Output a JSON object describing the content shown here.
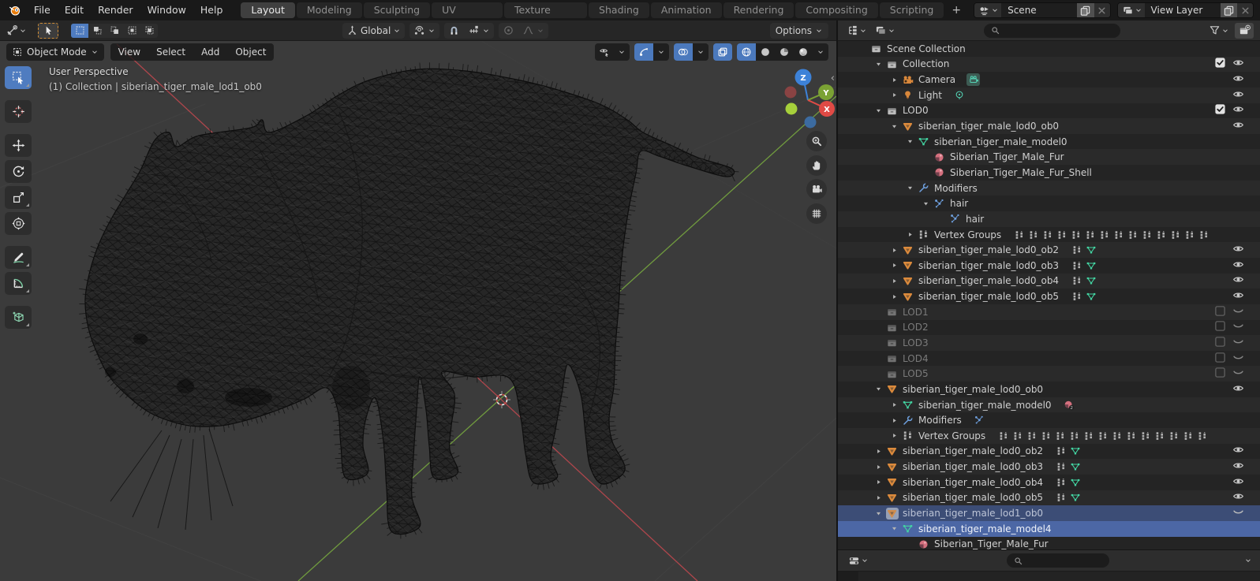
{
  "topbar": {
    "menus": [
      "File",
      "Edit",
      "Render",
      "Window",
      "Help"
    ],
    "tabs": [
      "Layout",
      "Modeling",
      "Sculpting",
      "UV Editing",
      "Texture Paint",
      "Shading",
      "Animation",
      "Rendering",
      "Compositing",
      "Scripting"
    ],
    "active_tab": "Layout",
    "add_tab_label": "+",
    "scene": {
      "value": "Scene"
    },
    "view_layer": {
      "value": "View Layer"
    }
  },
  "tool_settings": {
    "select_modes": [
      "set",
      "extend",
      "subtract",
      "invert",
      "intersect"
    ],
    "active_select_mode": "set",
    "orientation_label": "Global",
    "options_label": "Options"
  },
  "viewport": {
    "mode_label": "Object Mode",
    "menus": [
      "View",
      "Select",
      "Add",
      "Object"
    ],
    "overlay_line1": "User Perspective",
    "overlay_line2": "(1) Collection | siberian_tiger_male_lod1_ob0",
    "gizmo": {
      "x": "X",
      "y": "Y",
      "z": "Z"
    },
    "nav_buttons": [
      "zoom",
      "pan",
      "camera-view",
      "toggle-ortho"
    ],
    "shading_modes": [
      "wireframe",
      "solid",
      "material-preview",
      "rendered"
    ],
    "active_shading": "wireframe"
  },
  "toolbar_tools": [
    {
      "name": "select-box",
      "active": true,
      "sub": true
    },
    {
      "name": "cursor",
      "active": false,
      "sub": false
    },
    {
      "name": "move",
      "active": false,
      "sub": false
    },
    {
      "name": "rotate",
      "active": false,
      "sub": false
    },
    {
      "name": "scale",
      "active": false,
      "sub": true
    },
    {
      "name": "transform",
      "active": false,
      "sub": false
    },
    {
      "name": "annotate",
      "active": false,
      "sub": true
    },
    {
      "name": "measure",
      "active": false,
      "sub": true
    },
    {
      "name": "add-cube",
      "active": false,
      "sub": true
    }
  ],
  "outliner": {
    "search_placeholder": "",
    "rows": [
      {
        "label": "Scene Collection",
        "icon": "collection",
        "level": 0,
        "arrow": "none",
        "checkbox": "none",
        "eye": "none",
        "state": "normal",
        "badges": []
      },
      {
        "label": "Collection",
        "icon": "collection",
        "level": 1,
        "arrow": "open",
        "checkbox": "checked",
        "eye": "open",
        "state": "normal",
        "badges": []
      },
      {
        "label": "Camera",
        "icon": "camera-object",
        "level": 2,
        "arrow": "closed",
        "checkbox": "none",
        "eye": "open",
        "state": "normal",
        "badges": [
          {
            "type": "camera-data"
          }
        ]
      },
      {
        "label": "Light",
        "icon": "light-object",
        "level": 2,
        "arrow": "closed",
        "checkbox": "none",
        "eye": "open",
        "state": "normal",
        "badges": [
          {
            "type": "light-data"
          }
        ]
      },
      {
        "label": "LOD0",
        "icon": "collection",
        "level": 1,
        "arrow": "open",
        "checkbox": "checked",
        "eye": "open",
        "state": "normal",
        "badges": []
      },
      {
        "label": "siberian_tiger_male_lod0_ob0",
        "icon": "mesh-object",
        "level": 2,
        "arrow": "open",
        "checkbox": "none",
        "eye": "open",
        "state": "normal",
        "badges": []
      },
      {
        "label": "siberian_tiger_male_model0",
        "icon": "mesh-data",
        "level": 3,
        "arrow": "open",
        "checkbox": "none",
        "eye": "none",
        "state": "normal",
        "badges": []
      },
      {
        "label": "Siberian_Tiger_Male_Fur",
        "icon": "material",
        "level": 4,
        "arrow": "none",
        "checkbox": "none",
        "eye": "none",
        "state": "normal",
        "badges": []
      },
      {
        "label": "Siberian_Tiger_Male_Fur_Shell",
        "icon": "material",
        "level": 4,
        "arrow": "none",
        "checkbox": "none",
        "eye": "none",
        "state": "normal",
        "badges": []
      },
      {
        "label": "Modifiers",
        "icon": "modifier",
        "level": 3,
        "arrow": "open",
        "checkbox": "none",
        "eye": "none",
        "state": "normal",
        "badges": []
      },
      {
        "label": "hair",
        "icon": "particles",
        "level": 4,
        "arrow": "open",
        "checkbox": "none",
        "eye": "none",
        "state": "normal",
        "badges": []
      },
      {
        "label": "hair",
        "icon": "particles",
        "level": 5,
        "arrow": "none",
        "checkbox": "none",
        "eye": "none",
        "state": "normal",
        "badges": []
      },
      {
        "label": "Vertex Groups",
        "icon": "vertex-group",
        "level": 3,
        "arrow": "closed",
        "checkbox": "none",
        "eye": "none",
        "state": "normal",
        "badges": [
          {
            "type": "vertex-group",
            "count": 14
          }
        ]
      },
      {
        "label": "siberian_tiger_male_lod0_ob2",
        "icon": "mesh-object",
        "level": 2,
        "arrow": "closed",
        "checkbox": "none",
        "eye": "open",
        "state": "normal",
        "badges": [
          {
            "type": "vertex-group"
          },
          {
            "type": "mesh-data"
          }
        ]
      },
      {
        "label": "siberian_tiger_male_lod0_ob3",
        "icon": "mesh-object",
        "level": 2,
        "arrow": "closed",
        "checkbox": "none",
        "eye": "open",
        "state": "normal",
        "badges": [
          {
            "type": "vertex-group"
          },
          {
            "type": "mesh-data"
          }
        ]
      },
      {
        "label": "siberian_tiger_male_lod0_ob4",
        "icon": "mesh-object",
        "level": 2,
        "arrow": "closed",
        "checkbox": "none",
        "eye": "open",
        "state": "normal",
        "badges": [
          {
            "type": "vertex-group"
          },
          {
            "type": "mesh-data"
          }
        ]
      },
      {
        "label": "siberian_tiger_male_lod0_ob5",
        "icon": "mesh-object",
        "level": 2,
        "arrow": "closed",
        "checkbox": "none",
        "eye": "open",
        "state": "normal",
        "badges": [
          {
            "type": "vertex-group"
          },
          {
            "type": "mesh-data"
          }
        ]
      },
      {
        "label": "LOD1",
        "icon": "collection",
        "level": 1,
        "arrow": "none",
        "checkbox": "empty",
        "eye": "closed",
        "state": "grayed",
        "badges": []
      },
      {
        "label": "LOD2",
        "icon": "collection",
        "level": 1,
        "arrow": "none",
        "checkbox": "empty",
        "eye": "closed",
        "state": "grayed",
        "badges": []
      },
      {
        "label": "LOD3",
        "icon": "collection",
        "level": 1,
        "arrow": "none",
        "checkbox": "empty",
        "eye": "closed",
        "state": "grayed",
        "badges": []
      },
      {
        "label": "LOD4",
        "icon": "collection",
        "level": 1,
        "arrow": "none",
        "checkbox": "empty",
        "eye": "closed",
        "state": "grayed",
        "badges": []
      },
      {
        "label": "LOD5",
        "icon": "collection",
        "level": 1,
        "arrow": "none",
        "checkbox": "empty",
        "eye": "closed",
        "state": "grayed",
        "badges": []
      },
      {
        "label": "siberian_tiger_male_lod0_ob0",
        "icon": "mesh-object",
        "level": 1,
        "arrow": "open",
        "checkbox": "none",
        "eye": "open",
        "state": "normal",
        "badges": []
      },
      {
        "label": "siberian_tiger_male_model0",
        "icon": "mesh-data",
        "level": 2,
        "arrow": "closed",
        "checkbox": "none",
        "eye": "none",
        "state": "normal",
        "badges": [
          {
            "type": "material",
            "count": 2
          }
        ]
      },
      {
        "label": "Modifiers",
        "icon": "modifier",
        "level": 2,
        "arrow": "closed",
        "checkbox": "none",
        "eye": "none",
        "state": "normal",
        "badges": [
          {
            "type": "particles"
          }
        ]
      },
      {
        "label": "Vertex Groups",
        "icon": "vertex-group",
        "level": 2,
        "arrow": "closed",
        "checkbox": "none",
        "eye": "none",
        "state": "normal",
        "badges": [
          {
            "type": "vertex-group",
            "count": 15
          }
        ]
      },
      {
        "label": "siberian_tiger_male_lod0_ob2",
        "icon": "mesh-object",
        "level": 1,
        "arrow": "closed",
        "checkbox": "none",
        "eye": "open",
        "state": "normal",
        "badges": [
          {
            "type": "vertex-group"
          },
          {
            "type": "mesh-data"
          }
        ]
      },
      {
        "label": "siberian_tiger_male_lod0_ob3",
        "icon": "mesh-object",
        "level": 1,
        "arrow": "closed",
        "checkbox": "none",
        "eye": "open",
        "state": "normal",
        "badges": [
          {
            "type": "vertex-group"
          },
          {
            "type": "mesh-data"
          }
        ]
      },
      {
        "label": "siberian_tiger_male_lod0_ob4",
        "icon": "mesh-object",
        "level": 1,
        "arrow": "closed",
        "checkbox": "none",
        "eye": "open",
        "state": "normal",
        "badges": [
          {
            "type": "vertex-group"
          },
          {
            "type": "mesh-data"
          }
        ]
      },
      {
        "label": "siberian_tiger_male_lod0_ob5",
        "icon": "mesh-object",
        "level": 1,
        "arrow": "closed",
        "checkbox": "none",
        "eye": "open",
        "state": "normal",
        "badges": [
          {
            "type": "vertex-group"
          },
          {
            "type": "mesh-data"
          }
        ]
      },
      {
        "label": "siberian_tiger_male_lod1_ob0",
        "icon": "mesh-object",
        "level": 1,
        "arrow": "open",
        "checkbox": "none",
        "eye": "closed",
        "state": "active-sel",
        "badges": []
      },
      {
        "label": "siberian_tiger_male_model4",
        "icon": "mesh-data",
        "level": 2,
        "arrow": "open",
        "checkbox": "none",
        "eye": "none",
        "state": "selected",
        "badges": []
      },
      {
        "label": "Siberian_Tiger_Male_Fur",
        "icon": "material",
        "level": 3,
        "arrow": "none",
        "checkbox": "none",
        "eye": "none",
        "state": "normal",
        "badges": []
      }
    ]
  },
  "properties": {
    "search_placeholder": ""
  },
  "colors": {
    "accent_blue": "#4772b3",
    "object_orange": "#db8a3c",
    "data_green": "#43d6a3",
    "material_pink": "#d4707e",
    "modifier_blue": "#6fa1e0",
    "axis_red": "#c4484f",
    "axis_green": "#76a63f",
    "viewport_bg": "#3b3b3b"
  }
}
